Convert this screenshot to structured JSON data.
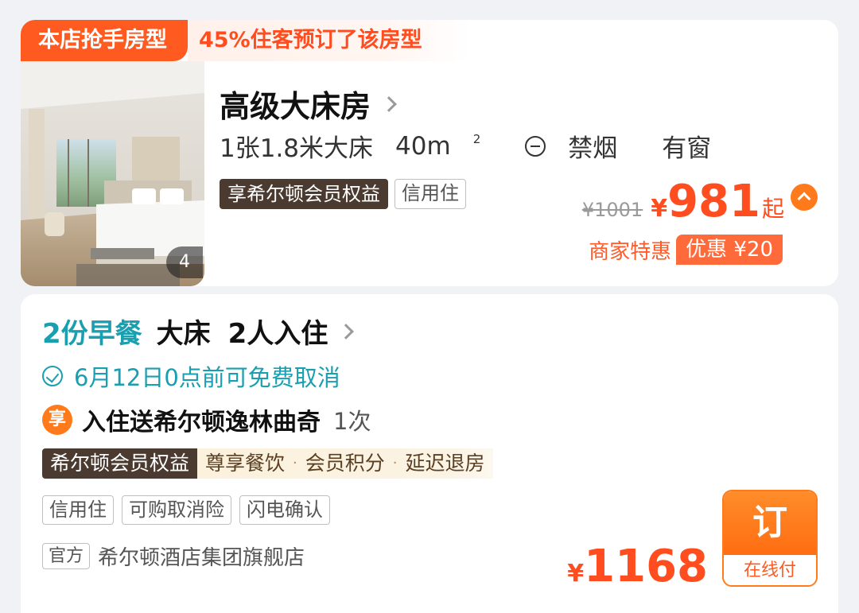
{
  "room": {
    "hot_tag": "本店抢手房型",
    "hot_stat": "45%住客预订了该房型",
    "photo_count": "4",
    "title": "高级大床房",
    "specs": {
      "bed": "1张1.8米大床",
      "area": "40m",
      "area_unit_sup": "2",
      "smoking": "禁烟",
      "window": "有窗"
    },
    "tags": [
      "享希尔顿会员权益",
      "信用住"
    ],
    "price": {
      "original": "¥1001",
      "symbol": "¥",
      "value": "981",
      "suffix": "起"
    },
    "promo": {
      "label": "商家特惠",
      "badge": "优惠 ¥20"
    }
  },
  "offer": {
    "meal": "2份早餐",
    "bed_type": "大床",
    "occupancy": "2人入住",
    "cancellation": "6月12日0点前可免费取消",
    "perk": {
      "icon_text": "享",
      "text": "入住送希尔顿逸林曲奇",
      "count": "1次"
    },
    "member": {
      "label": "希尔顿会员权益",
      "perks": [
        "尊享餐饮",
        "会员积分",
        "延迟退房"
      ],
      "separator": "·"
    },
    "service_tags": [
      "信用住",
      "可购取消险",
      "闪电确认"
    ],
    "store": {
      "tag": "官方",
      "name": "希尔顿酒店集团旗舰店"
    },
    "price": {
      "symbol": "¥",
      "value": "1168"
    },
    "book_button": {
      "main": "订",
      "sub": "在线付"
    }
  },
  "colors": {
    "accent_orange": "#ff5a1f",
    "teal": "#1a9fb0",
    "dark_brown": "#4a3a2f"
  }
}
